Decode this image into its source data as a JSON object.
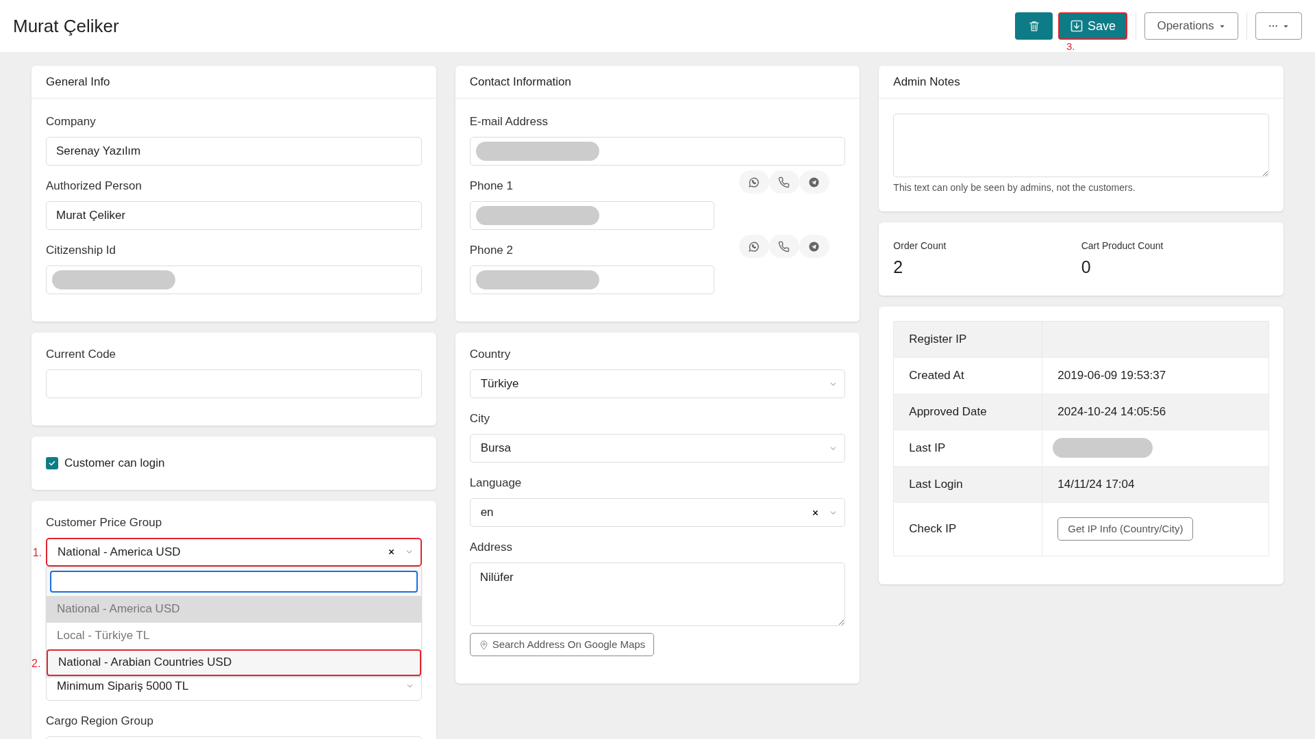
{
  "header": {
    "title": "Murat Çeliker",
    "buttons": [
      {
        "kind": "delete",
        "highlighted": false
      },
      {
        "kind": "save",
        "label": "Save",
        "highlighted": true,
        "annotation": "3."
      },
      {
        "kind": "menu",
        "label": "Operations",
        "highlighted": false
      },
      {
        "kind": "more",
        "highlighted": false
      }
    ]
  },
  "columns": [
    {
      "cards": [
        {
          "title": "General Info",
          "fields": [
            {
              "kind": "input",
              "label": "Company",
              "value": "Serenay Yazılım"
            },
            {
              "kind": "input",
              "label": "Authorized Person",
              "value": "Murat Çeliker"
            },
            {
              "kind": "input",
              "label": "Citizenship Id",
              "redacted": true
            }
          ]
        },
        {
          "fields": [
            {
              "kind": "input",
              "label": "Current Code"
            }
          ]
        },
        {
          "fields": [
            {
              "kind": "checkbox",
              "label": "Customer can login",
              "checked": true
            }
          ]
        },
        {
          "fields": [
            {
              "kind": "select",
              "label": "Customer Price Group",
              "value": "National - America USD",
              "clearable": true,
              "highlighted": true,
              "annotation": "1.",
              "open": true,
              "options": [
                {
                  "label": "National - America USD",
                  "selected": true,
                  "highlighted": false
                },
                {
                  "label": "Local - Türkiye TL",
                  "selected": false,
                  "highlighted": false
                },
                {
                  "label": "National - Arabian Countries USD",
                  "selected": false,
                  "highlighted": true,
                  "annotation": "2."
                }
              ]
            },
            {
              "kind": "select",
              "value": "Minimum Sipariş 5000 TL",
              "clearable": false
            },
            {
              "kind": "input",
              "label": "Cargo Region Group"
            }
          ]
        }
      ]
    },
    {
      "cards": [
        {
          "title": "Contact Information",
          "fields": [
            {
              "kind": "input",
              "label": "E-mail Address",
              "redacted": true
            },
            {
              "kind": "phone",
              "label": "Phone 1",
              "redacted": true
            },
            {
              "kind": "phone",
              "label": "Phone 2",
              "redacted": true
            }
          ]
        },
        {
          "fields": [
            {
              "kind": "select",
              "label": "Country",
              "value": "Türkiye",
              "clearable": false
            },
            {
              "kind": "select",
              "label": "City",
              "value": "Bursa",
              "clearable": false
            },
            {
              "kind": "select",
              "label": "Language",
              "value": "en",
              "clearable": true
            },
            {
              "kind": "textarea",
              "label": "Address",
              "value": "Nilüfer",
              "button": "Search Address On Google Maps"
            }
          ]
        }
      ]
    },
    {
      "cards": [
        {
          "title": "Admin Notes",
          "fields": [
            {
              "kind": "textarea",
              "hint": "This text can only be seen by admins, not the customers."
            }
          ]
        },
        {
          "fields": [
            {
              "kind": "stats",
              "stats": [
                {
                  "label": "Order Count",
                  "value": "2"
                },
                {
                  "label": "Cart Product Count",
                  "value": "0"
                }
              ]
            }
          ]
        },
        {
          "fields": [
            {
              "kind": "table",
              "rows": [
                {
                  "label": "Register IP"
                },
                {
                  "label": "Created At",
                  "value": "2019-06-09 19:53:37"
                },
                {
                  "label": "Approved Date",
                  "value": "2024-10-24 14:05:56"
                },
                {
                  "label": "Last IP",
                  "redacted": true
                },
                {
                  "label": "Last Login",
                  "value": "14/11/24 17:04"
                },
                {
                  "label": "Check IP",
                  "button": "Get IP Info (Country/City)"
                }
              ]
            }
          ]
        }
      ]
    }
  ]
}
